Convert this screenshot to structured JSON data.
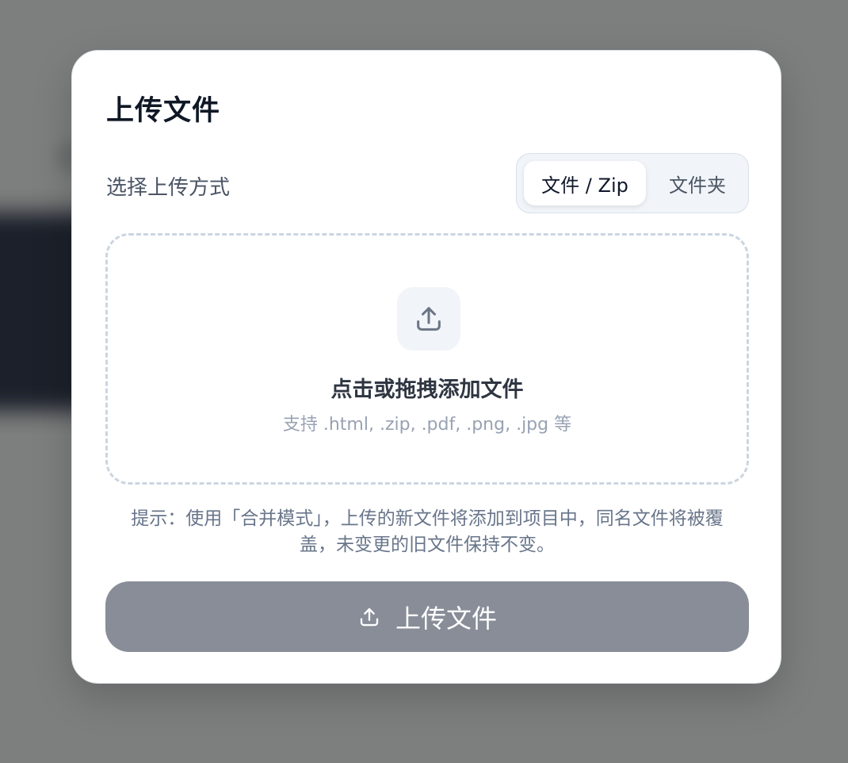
{
  "modal": {
    "title": "上传文件",
    "mode_label": "选择上传方式",
    "modes": [
      {
        "label": "文件 / Zip",
        "active": true
      },
      {
        "label": "文件夹",
        "active": false
      }
    ]
  },
  "dropzone": {
    "icon": "upload-icon",
    "title": "点击或拖拽添加文件",
    "subtitle": "支持 .html, .zip, .pdf, .png, .jpg 等"
  },
  "hint": "提示：使用「合并模式」，上传的新文件将添加到项目中，同名文件将被覆盖，未变更的旧文件保持不变。",
  "upload_button": {
    "label": "上传文件",
    "icon": "upload-icon"
  },
  "colors": {
    "button_bg": "#888d98",
    "dropzone_border": "#cbd5e1",
    "title_text": "#101826"
  }
}
